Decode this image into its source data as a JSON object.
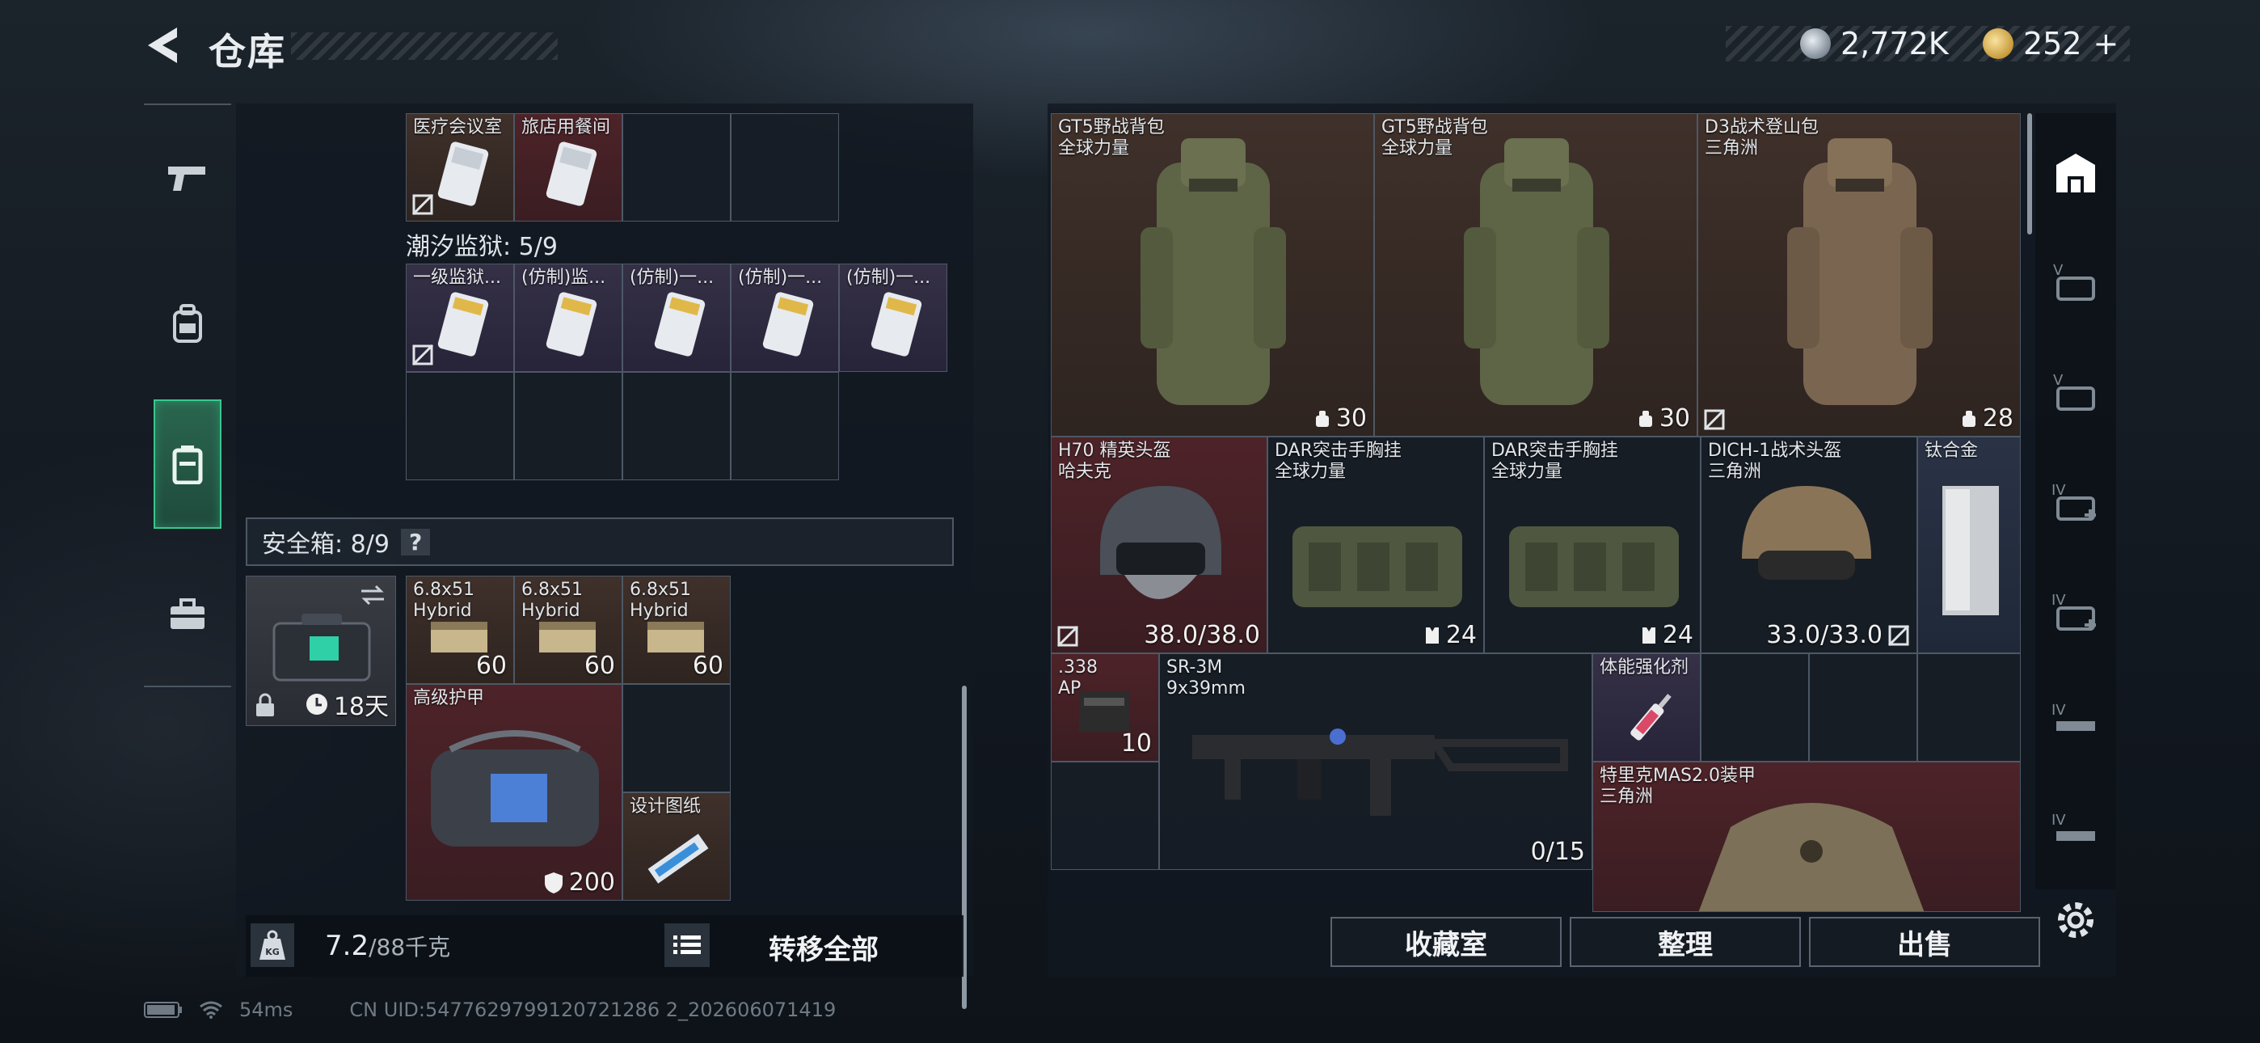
{
  "header": {
    "title": "仓库",
    "currency_silver": "2,772K",
    "currency_gold": "252",
    "plus": "+"
  },
  "left": {
    "top_items": [
      {
        "label": "医疗会议室"
      },
      {
        "label": "旅店用餐间"
      }
    ],
    "prison_label": "潮汐监狱: 5/9",
    "prison_items": [
      {
        "label": "一级监狱..."
      },
      {
        "label": "(仿制)监..."
      },
      {
        "label": "(仿制)一..."
      },
      {
        "label": "(仿制)一..."
      },
      {
        "label": "(仿制)一..."
      }
    ],
    "safe_label": "安全箱: 8/9",
    "safe_help": "?",
    "safe_case_days": "18天",
    "ammo": [
      {
        "l1": "6.8x51",
        "l2": "Hybrid",
        "count": "60"
      },
      {
        "l1": "6.8x51",
        "l2": "Hybrid",
        "count": "60"
      },
      {
        "l1": "6.8x51",
        "l2": "Hybrid",
        "count": "60"
      }
    ],
    "armor_label": "高级护甲",
    "armor_value": "200",
    "blueprint_label": "设计图纸",
    "weight_value": "7.2",
    "weight_total": "/88千克",
    "transfer_all": "转移全部"
  },
  "right": {
    "backpacks": [
      {
        "name": "GT5野战背包",
        "brand": "全球力量",
        "count": "30"
      },
      {
        "name": "GT5野战背包",
        "brand": "全球力量",
        "count": "30"
      },
      {
        "name": "D3战术登山包",
        "brand": "三角洲",
        "count": "28"
      }
    ],
    "helmet1": {
      "name": "H70 精英头盔",
      "brand": "哈夫克",
      "durability": "38.0/38.0"
    },
    "rig1": {
      "name": "DAR突击手胸挂",
      "brand": "全球力量",
      "count": "24"
    },
    "rig2": {
      "name": "DAR突击手胸挂",
      "brand": "全球力量",
      "count": "24"
    },
    "helmet2": {
      "name": "DICH-1战术头盔",
      "brand": "三角洲",
      "durability": "33.0/33.0"
    },
    "titanium": {
      "name": "钛合金"
    },
    "ammo338": {
      "l1": ".338",
      "l2": "AP",
      "count": "10"
    },
    "gun": {
      "name": "SR-3M",
      "caliber": "9x39mm",
      "ammo": "0/15"
    },
    "stim": {
      "name": "体能强化剂"
    },
    "armor2": {
      "name": "特里克MAS2.0装甲",
      "brand": "三角洲"
    },
    "buttons": {
      "collection": "收藏室",
      "organize": "整理",
      "sell": "出售"
    }
  },
  "footer": {
    "ping": "54ms",
    "uid": "CN UID:5477629799120721286 2_202606071419"
  },
  "colors": {
    "accent_green": "#38c78f",
    "cell_red": "#4d2328",
    "cell_purple": "#353046"
  }
}
